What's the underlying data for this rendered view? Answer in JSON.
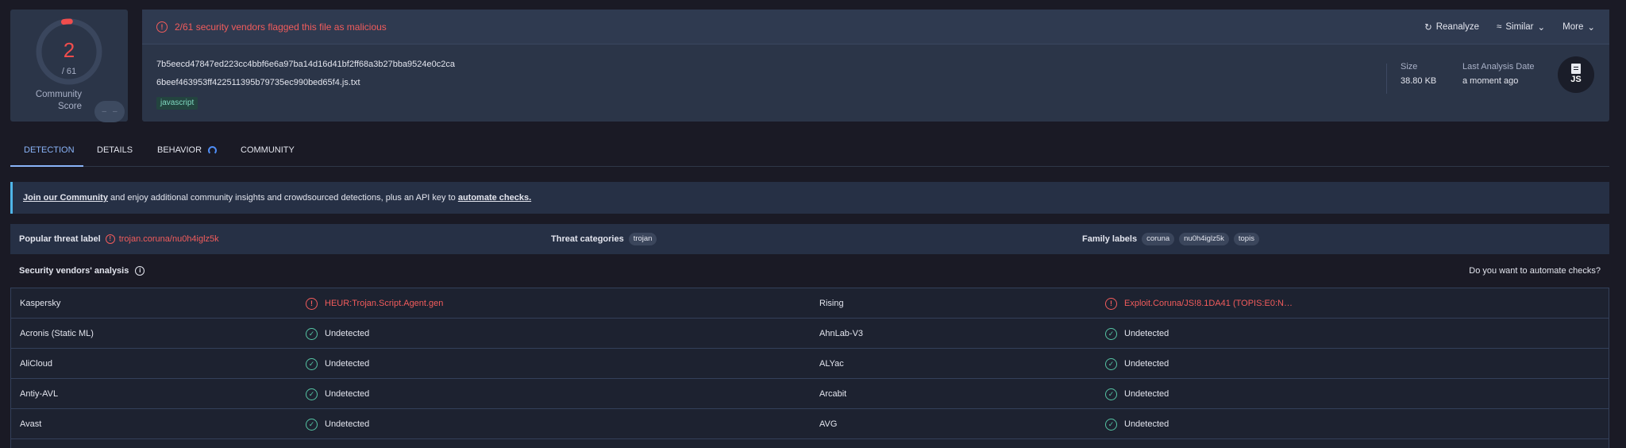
{
  "score": {
    "detections": "2",
    "total": "/ 61",
    "community_label": "Community Score",
    "malicious_fraction": 0.033,
    "accent_color": "#f04d4d"
  },
  "header": {
    "flag_message": "2/61 security vendors flagged this file as malicious",
    "actions": [
      {
        "label": "Reanalyze",
        "icon": "refresh-icon"
      },
      {
        "label": "Similar",
        "icon": "similar-icon"
      },
      {
        "label": "More",
        "icon": "chevron-down-icon"
      }
    ],
    "sha256": "7b5eecd47847ed223cc4bbf6e6a97ba14d16d41bf2ff68a3b27bba9524e0c2ca",
    "file_name": "6beef463953ff422511395b79735ec990bed65f4.js.txt",
    "tag": "javascript",
    "size_label": "Size",
    "size_value": "38.80 KB",
    "date_label": "Last Analysis Date",
    "date_value": "a moment ago",
    "file_type_badge": "JS"
  },
  "tabs": [
    {
      "label": "DETECTION",
      "active": true
    },
    {
      "label": "DETAILS",
      "active": false
    },
    {
      "label": "BEHAVIOR",
      "active": false
    },
    {
      "label": "COMMUNITY",
      "active": false
    }
  ],
  "banner": {
    "link1": "Join our Community",
    "middle": " and enjoy additional community insights and crowdsourced detections, plus an API key to ",
    "link2": "automate checks."
  },
  "labels": {
    "popular_title": "Popular threat label",
    "popular_value": "trojan.coruna/nu0h4iglz5k",
    "categories_title": "Threat categories",
    "categories": [
      "trojan"
    ],
    "family_title": "Family labels",
    "families": [
      "coruna",
      "nu0h4iglz5k",
      "topis"
    ]
  },
  "vendors_header": {
    "title": "Security vendors' analysis",
    "automate_text": "Do you want to automate checks?"
  },
  "vendor_rows": [
    {
      "v1": "Kaspersky",
      "r1": "HEUR:Trojan.Script.Agent.gen",
      "m1": true,
      "v2": "Rising",
      "r2": "Exploit.Coruna/JS!8.1DA41 (TOPIS:E0:N…",
      "m2": true
    },
    {
      "v1": "Acronis (Static ML)",
      "r1": "Undetected",
      "m1": false,
      "v2": "AhnLab-V3",
      "r2": "Undetected",
      "m2": false
    },
    {
      "v1": "AliCloud",
      "r1": "Undetected",
      "m1": false,
      "v2": "ALYac",
      "r2": "Undetected",
      "m2": false
    },
    {
      "v1": "Antiy-AVL",
      "r1": "Undetected",
      "m1": false,
      "v2": "Arcabit",
      "r2": "Undetected",
      "m2": false
    },
    {
      "v1": "Avast",
      "r1": "Undetected",
      "m1": false,
      "v2": "AVG",
      "r2": "Undetected",
      "m2": false
    },
    {
      "v1": "",
      "r1": "",
      "m1": false,
      "v2": "",
      "r2": "",
      "m2": false
    }
  ]
}
